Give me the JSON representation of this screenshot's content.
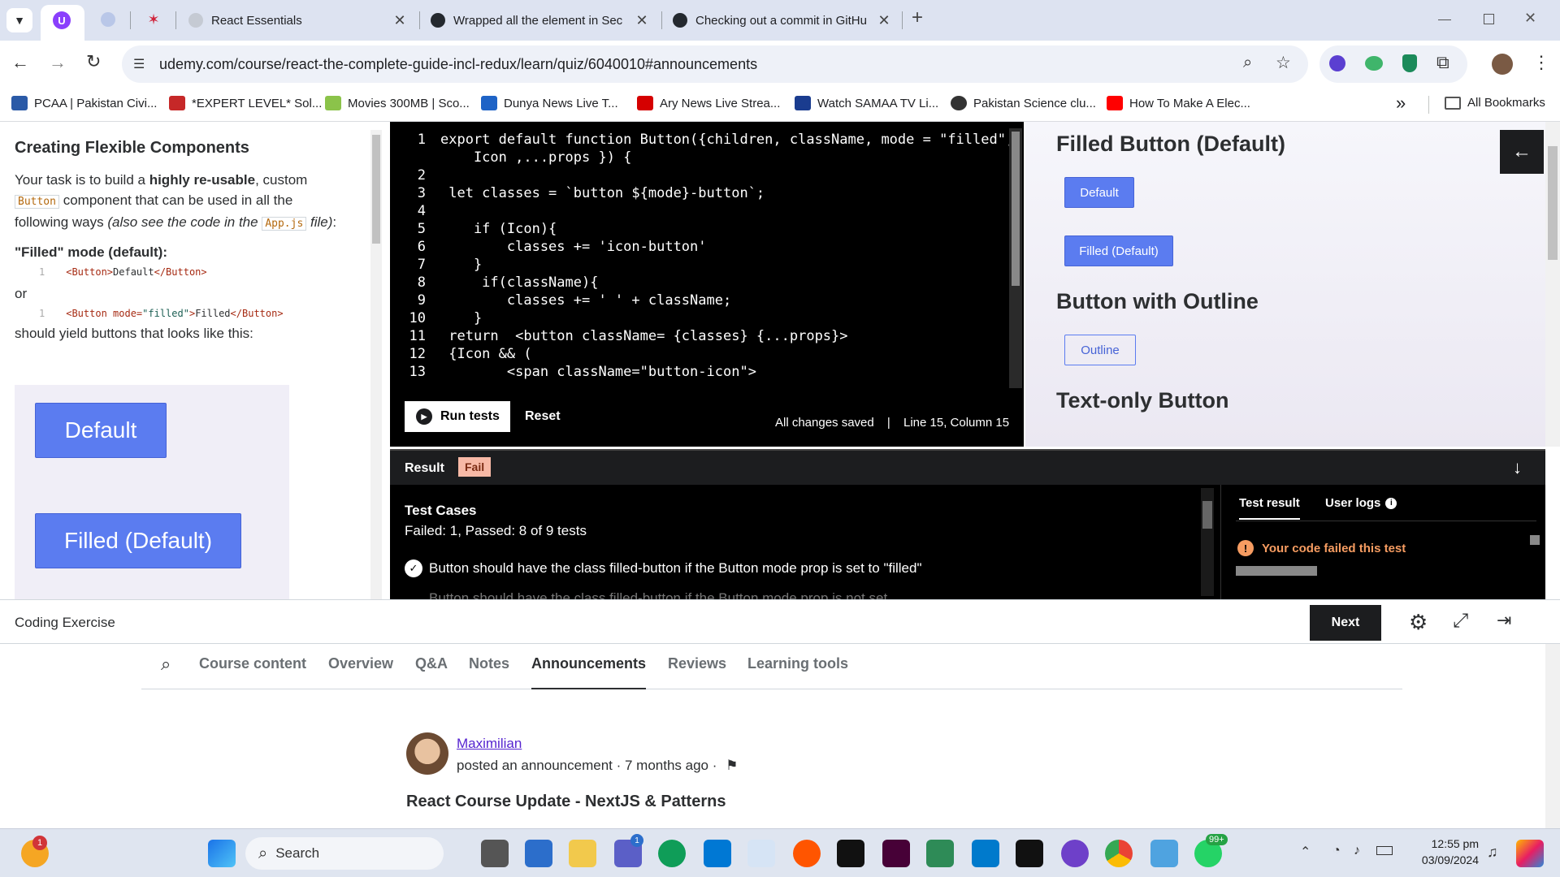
{
  "browser": {
    "tabs": [
      {
        "title": "React Essentials",
        "color": "#8a8f98"
      },
      {
        "title": "Wrapped all the element in Sec",
        "color": "#24292f"
      },
      {
        "title": "Checking out a commit in GitHu",
        "color": "#24292f"
      }
    ],
    "new_tab_label": "+",
    "url": "udemy.com/course/react-the-complete-guide-incl-redux/learn/quiz/6040010#announcements",
    "bookmarks": [
      {
        "label": "PCAA | Pakistan Civi...",
        "color": "#2b5aa7"
      },
      {
        "label": "*EXPERT LEVEL* Sol...",
        "color": "#c62828"
      },
      {
        "label": "Movies 300MB | Sco...",
        "color": "#8bc34a"
      },
      {
        "label": "Dunya News Live T...",
        "color": "#1e63c6"
      },
      {
        "label": "Ary News Live Strea...",
        "color": "#d50000"
      },
      {
        "label": "Watch SAMAA TV Li...",
        "color": "#1a3c8f"
      },
      {
        "label": "Pakistan Science clu...",
        "color": "#333333"
      },
      {
        "label": "How To Make A Elec...",
        "color": "#ff0000"
      }
    ],
    "overflow_label": "»",
    "all_bookmarks_label": "All Bookmarks"
  },
  "instructions": {
    "heading": "Creating Flexible Components",
    "para_1": "Your task is to build a",
    "para_bold": "highly re-usable",
    "para_2": ", custom",
    "code_button": "Button",
    "para_3": "component that can be used in all the following ways",
    "para_italic": "(also see the code in the",
    "code_app": "App.js",
    "para_italic_end": "file)",
    "para_end": ":",
    "filled_heading": "\"Filled\" mode (default):",
    "snippet_1_num": "1",
    "snippet_1_a": "<Button>",
    "snippet_1_b": "Default",
    "snippet_1_c": "</Button>",
    "or_text": "or",
    "snippet_2_num": "1",
    "snippet_2_a": "<Button mode=",
    "snippet_2_b": "\"filled\"",
    "snippet_2_c": ">",
    "snippet_2_d": "Filled",
    "snippet_2_e": "</Button>",
    "yield_text": "should yield buttons that looks like this:",
    "example_default": "Default",
    "example_filled": "Filled (Default)"
  },
  "editor": {
    "lines": [
      {
        "n": "1",
        "text": "export default function Button({children, className, mode = \"filled\","
      },
      {
        "n": "",
        "text": "    Icon ,...props }) {"
      },
      {
        "n": "2",
        "text": ""
      },
      {
        "n": "3",
        "text": " let classes = `button ${mode}-button`;"
      },
      {
        "n": "4",
        "text": ""
      },
      {
        "n": "5",
        "text": "    if (Icon){"
      },
      {
        "n": "6",
        "text": "        classes += 'icon-button'"
      },
      {
        "n": "7",
        "text": "    }"
      },
      {
        "n": "8",
        "text": "     if(className){"
      },
      {
        "n": "9",
        "text": "        classes += ' ' + className;"
      },
      {
        "n": "10",
        "text": "    }"
      },
      {
        "n": "11",
        "text": " return  <button className= {classes} {...props}>"
      },
      {
        "n": "12",
        "text": " {Icon && ("
      },
      {
        "n": "13",
        "text": "        <span className=\"button-icon\">"
      }
    ],
    "run_label": "Run tests",
    "reset_label": "Reset",
    "saved_status": "All changes saved",
    "separator": "|",
    "cursor_position": "Line 15, Column 15"
  },
  "preview": {
    "heading_filled": "Filled Button (Default)",
    "btn_default": "Default",
    "btn_filled": "Filled (Default)",
    "heading_outline": "Button with Outline",
    "btn_outline": "Outline",
    "heading_text": "Text-only Button"
  },
  "result": {
    "label": "Result",
    "badge": "Fail",
    "test_cases_title": "Test Cases",
    "summary": "Failed: 1, Passed: 8 of 9 tests",
    "test_1": "Button should have the class filled-button if the Button mode prop is set to \"filled\"",
    "test_2": "Button should have the class filled-button if the Button mode prop is not set",
    "tab_test_result": "Test result",
    "tab_user_logs": "User logs",
    "failed_message": "Your code failed this test"
  },
  "footer": {
    "title": "Coding Exercise",
    "next_label": "Next"
  },
  "course_tabs": [
    "Course content",
    "Overview",
    "Q&A",
    "Notes",
    "Announcements",
    "Reviews",
    "Learning tools"
  ],
  "active_tab": "Announcements",
  "announcement": {
    "author": "Maximilian",
    "meta": "posted an announcement · 7 months ago ·",
    "title": "React Course Update - NextJS & Patterns"
  },
  "taskbar": {
    "search_label": "Search",
    "notification_badge": "1",
    "teams_badge": "1",
    "whatsapp_badge": "99+",
    "time": "12:55 pm",
    "date": "03/09/2024"
  },
  "colors": {
    "accent_purple": "#5624d0",
    "button_blue": "#5b7cf0",
    "fail_badge": "#f7b9a6",
    "pass_green": "#1e6055",
    "error_orange": "#f69c61"
  }
}
